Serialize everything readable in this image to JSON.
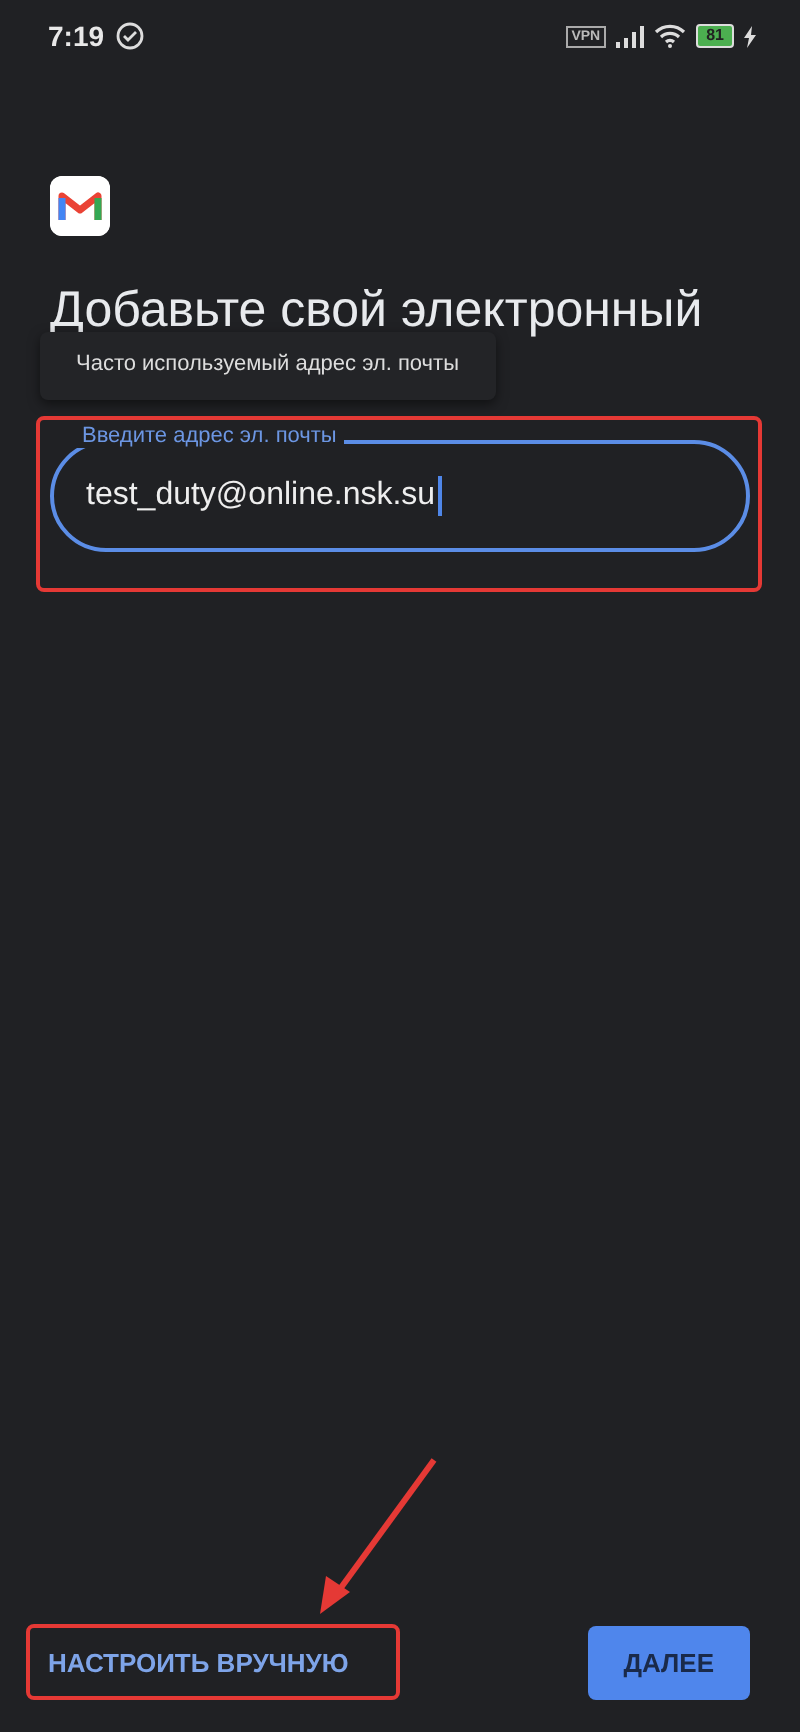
{
  "status_bar": {
    "time": "7:19",
    "vpn": "VPN",
    "battery": "81"
  },
  "heading": "Добавьте свой электронный",
  "tooltip": "Часто используемый адрес эл. почты",
  "email_field": {
    "label": "Введите адрес эл. почты",
    "value": "test_duty@online.nsk.su",
    "focused": true
  },
  "buttons": [
    {
      "kind": "text",
      "label": "НАСТРОИТЬ ВРУЧНУЮ"
    },
    {
      "kind": "filled",
      "label": "ДАЛЕЕ"
    }
  ]
}
